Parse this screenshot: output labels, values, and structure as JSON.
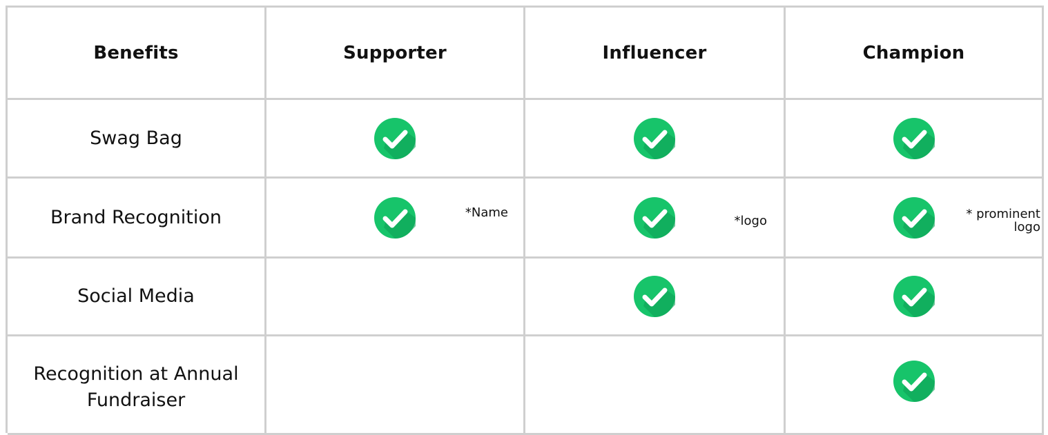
{
  "header": {
    "benefits": "Benefits",
    "supporter": "Supporter",
    "influencer": "Influencer",
    "champion": "Champion"
  },
  "rows": [
    {
      "label": "Swag Bag",
      "supporter": true,
      "influencer": true,
      "champion": true
    },
    {
      "label": "Brand Recognition",
      "supporter": true,
      "influencer": true,
      "champion": true,
      "notes": {
        "supporter": "*Name",
        "influencer": "*logo",
        "champion_line1": "* prominent",
        "champion_line2": "logo"
      }
    },
    {
      "label": "Social Media",
      "supporter": false,
      "influencer": true,
      "champion": true
    },
    {
      "label_line1": "Recognition at Annual",
      "label_line2": "Fundraiser",
      "supporter": false,
      "influencer": false,
      "champion": true
    }
  ],
  "colors": {
    "grid_line": "#cfcfcf",
    "check_light": "#17c46a",
    "check_dark": "#0ea257",
    "check_mark": "#ffffff"
  },
  "icons": {
    "check": "check-circle-icon"
  }
}
